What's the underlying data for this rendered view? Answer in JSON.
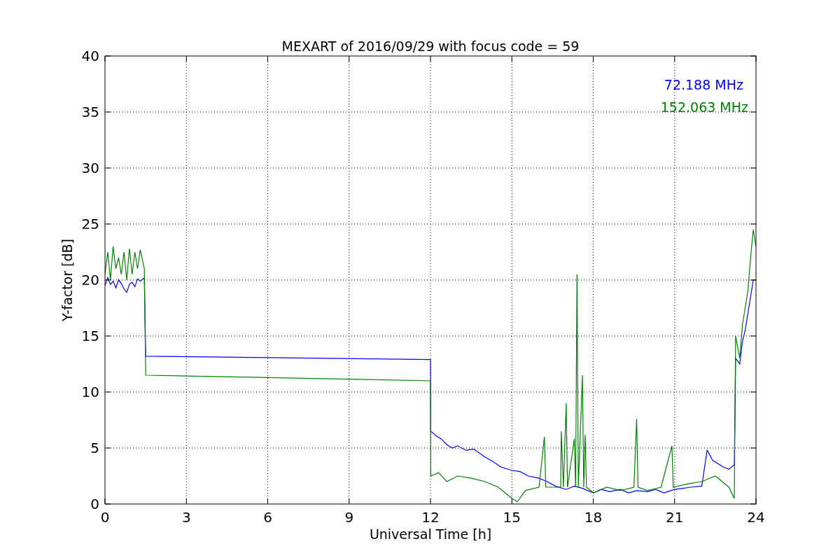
{
  "chart_data": {
    "type": "line",
    "title": "MEXART of 2016/09/29 with focus code = 59",
    "xlabel": "Universal Time [h]",
    "ylabel": "Y-factor [dB]",
    "xlim": [
      0,
      24
    ],
    "ylim": [
      0,
      40
    ],
    "xticks": [
      0,
      3,
      6,
      9,
      12,
      15,
      18,
      21,
      24
    ],
    "yticks": [
      0,
      5,
      10,
      15,
      20,
      25,
      30,
      35,
      40
    ],
    "grid": true,
    "series": [
      {
        "name": "72.188 MHz",
        "color": "#0000ff",
        "x": [
          0,
          0.1,
          0.2,
          0.3,
          0.4,
          0.5,
          0.6,
          0.7,
          0.8,
          0.9,
          1.0,
          1.1,
          1.2,
          1.3,
          1.45,
          1.5,
          12.0,
          12.01,
          12.2,
          12.4,
          12.6,
          12.8,
          13,
          13.3,
          13.6,
          14,
          14.3,
          14.6,
          15,
          15.3,
          15.6,
          16,
          16.3,
          16.6,
          17,
          17.3,
          17.6,
          18,
          18.3,
          18.6,
          19,
          19.3,
          19.6,
          20,
          20.3,
          20.6,
          21,
          21.3,
          21.6,
          22,
          22.2,
          22.4,
          22.6,
          22.8,
          23,
          23.2,
          23.25,
          23.4,
          23.5,
          23.6,
          23.7,
          23.8,
          23.9,
          24
        ],
        "values": [
          19.5,
          20.2,
          19.6,
          19.9,
          19.3,
          20.0,
          19.7,
          19.2,
          18.9,
          19.6,
          19.8,
          19.4,
          20.1,
          19.9,
          20.2,
          13.2,
          12.9,
          6.5,
          6.1,
          5.8,
          5.3,
          5.0,
          5.2,
          4.8,
          4.9,
          4.2,
          3.8,
          3.3,
          3.0,
          2.9,
          2.5,
          2.3,
          2.0,
          1.6,
          1.3,
          1.6,
          1.4,
          1.0,
          1.3,
          1.1,
          1.3,
          1.0,
          1.2,
          1.1,
          1.3,
          1.0,
          1.3,
          1.4,
          1.5,
          1.6,
          4.8,
          3.9,
          3.6,
          3.3,
          3.1,
          3.5,
          13,
          12.5,
          14.5,
          15.5,
          17,
          18.5,
          20,
          20
        ]
      },
      {
        "name": "152.063 MHz",
        "color": "#008000",
        "x": [
          0,
          0.1,
          0.2,
          0.3,
          0.4,
          0.5,
          0.6,
          0.7,
          0.8,
          0.9,
          1.0,
          1.1,
          1.2,
          1.3,
          1.45,
          1.5,
          12.0,
          12.01,
          12.3,
          12.6,
          13,
          13.5,
          14,
          14.5,
          15,
          15.2,
          15.5,
          16,
          16.2,
          16.25,
          16.8,
          16.82,
          16.9,
          17.0,
          17.05,
          17.3,
          17.35,
          17.4,
          17.45,
          17.6,
          17.65,
          17.7,
          17.75,
          18,
          18.5,
          19,
          19.5,
          19.6,
          19.65,
          20,
          20.5,
          20.9,
          20.95,
          21.5,
          22,
          22.5,
          23,
          23.2,
          23.25,
          23.4,
          23.5,
          23.7,
          23.8,
          23.9,
          24
        ],
        "values": [
          20.5,
          22.5,
          20,
          23,
          21,
          22,
          20.5,
          22.5,
          20,
          22.8,
          20.5,
          22.5,
          21,
          22.7,
          21,
          11.5,
          11.0,
          2.5,
          2.8,
          2.0,
          2.5,
          2.3,
          2.0,
          1.5,
          0.5,
          0.2,
          1.2,
          1.5,
          6,
          1.5,
          1.5,
          6.5,
          1.5,
          9,
          1.5,
          5.8,
          1.5,
          20.5,
          1.5,
          11.5,
          1.5,
          6.2,
          1.5,
          1.0,
          1.5,
          1.2,
          1.5,
          7.6,
          1.5,
          1.2,
          1.5,
          5.2,
          1.5,
          1.8,
          2.0,
          2.5,
          1.5,
          0.5,
          15,
          13,
          16,
          19,
          22,
          24.5,
          23
        ]
      }
    ]
  }
}
